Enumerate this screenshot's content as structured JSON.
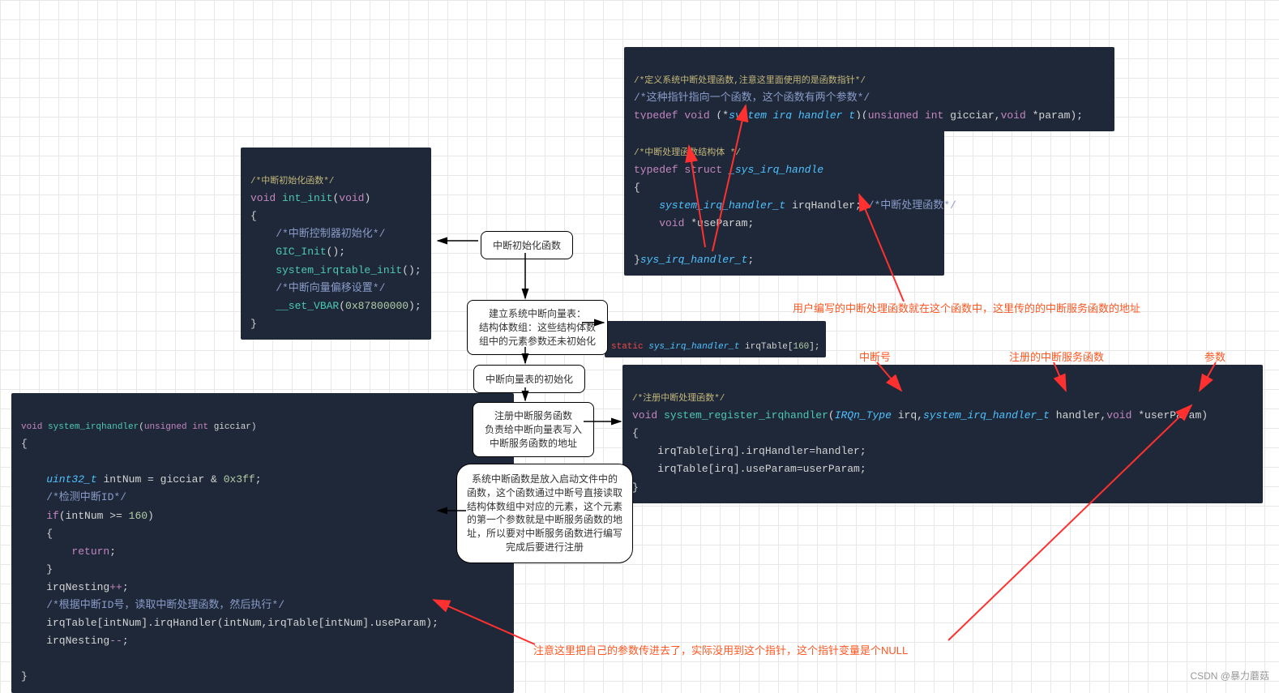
{
  "codebox1": {
    "comment_title": "/*中断初始化函数*/",
    "l1_a": "void",
    "l1_b": "int_init",
    "l1_c": "(",
    "l1_d": "void",
    "l1_e": ")",
    "l2": "{",
    "l3": "    /*中断控制器初始化*/",
    "l4_a": "    GIC_Init",
    "l4_b": "();",
    "l5_a": "    system_irqtable_init",
    "l5_b": "();",
    "l6": "    /*中断向量偏移设置*/",
    "l7_a": "    __set_VBAR",
    "l7_b": "(",
    "l7_c": "0x87800000",
    "l7_d": ");",
    "l8": "}"
  },
  "codebox2": {
    "comment_title": "/*定义系统中断处理函数,注意这里面使用的是函数指针*/",
    "c0": "/*这种指针指向一个函数，这个函数有两个参数*/",
    "l1_a": "typedef",
    "l1_b": "void",
    "l1_c": "(*",
    "l1_d": "system_irq_handler_t",
    "l1_e": ")(",
    "l1_f": "unsigned",
    "l1_g": "int",
    "l1_h": "gicciar,",
    "l1_i": "void",
    "l1_j": "*param);"
  },
  "codebox3": {
    "comment_title": "/*中断处理函数结构体 */",
    "l1_a": "typedef",
    "l1_b": "struct",
    "l1_c": "_sys_irq_handle",
    "l2": "{",
    "l3_a": "    system_irq_handler_t",
    "l3_b": "irqHandler;",
    "l3_c": "/*中断处理函数*/",
    "l4_a": "    void",
    "l4_b": "*useParam;",
    "l5": "",
    "l6_a": "}",
    "l6_b": "sys_irq_handler_t",
    "l6_c": ";"
  },
  "codebox4": {
    "l1_a": "static",
    "l1_b": "sys_irq_handler_t",
    "l1_c": "irqTable[",
    "l1_d": "160",
    "l1_e": "];"
  },
  "codebox5": {
    "comment_title": "/*注册中断处理函数*/",
    "l1_a": "void",
    "l1_b": "system_register_irqhandler",
    "l1_c": "(",
    "l1_d": "IRQn_Type",
    "l1_e": "irq,",
    "l1_f": "system_irq_handler_t",
    "l1_g": "handler,",
    "l1_h": "void",
    "l1_i": "*userParam)",
    "l2": "{",
    "l3": "    irqTable[irq].irqHandler=handler;",
    "l4": "    irqTable[irq].useParam=userParam;",
    "l5": "}"
  },
  "codebox6": {
    "l0_a": "void",
    "l0_b": "system_irqhandler",
    "l0_c": "(",
    "l0_d": "unsigned",
    "l0_e": "int",
    "l0_f": "gicciar)",
    "l1": "{",
    "l2": "",
    "l3_a": "    uint32_t",
    "l3_b": "intNum = gicciar &",
    "l3_c": "0x3ff",
    "l3_d": ";",
    "l4": "    /*检测中断ID*/",
    "l5_a": "    if",
    "l5_b": "(intNum >=",
    "l5_c": "160",
    "l5_d": ")",
    "l6": "    {",
    "l7_a": "        return",
    "l7_b": ";",
    "l8": "    }",
    "l9_a": "    irqNesting",
    "l9_b": "++",
    "l9_c": ";",
    "l10": "    /*根据中断ID号，读取中断处理函数，然后执行*/",
    "l11": "    irqTable[intNum].irqHandler(intNum,irqTable[intNum].useParam);",
    "l12_a": "    irqNesting",
    "l12_b": "--",
    "l12_c": ";",
    "l13": "",
    "l14": "}"
  },
  "flow": {
    "f1": "中断初始化函数",
    "f2": "建立系统中断向量表：\n结构体数组：这些结构体数\n组中的元素参数还未初始化",
    "f3": "中断向量表的初始化",
    "f4": "注册中断服务函数\n负责给中断向量表写入\n中断服务函数的地址",
    "f5": "系统中断函数是放入启动文件中的\n函数，这个函数通过中断号直接读取\n结构体数组中对应的元素，这个元素\n的第一个参数就是中断服务函数的地\n址，所以要对中断服务函数进行编写\n完成后要进行注册"
  },
  "anno": {
    "a1": "用户编写的中断处理函数就在这个函数中，这里传的的中断服务函数的地址",
    "a2": "中断号",
    "a3": "注册的中断服务函数",
    "a4": "参数",
    "a5": "注意这里把自己的参数传进去了，实际没用到这个指针，这个指针变量是个NULL"
  },
  "footer": "CSDN @暴力蘑菇"
}
